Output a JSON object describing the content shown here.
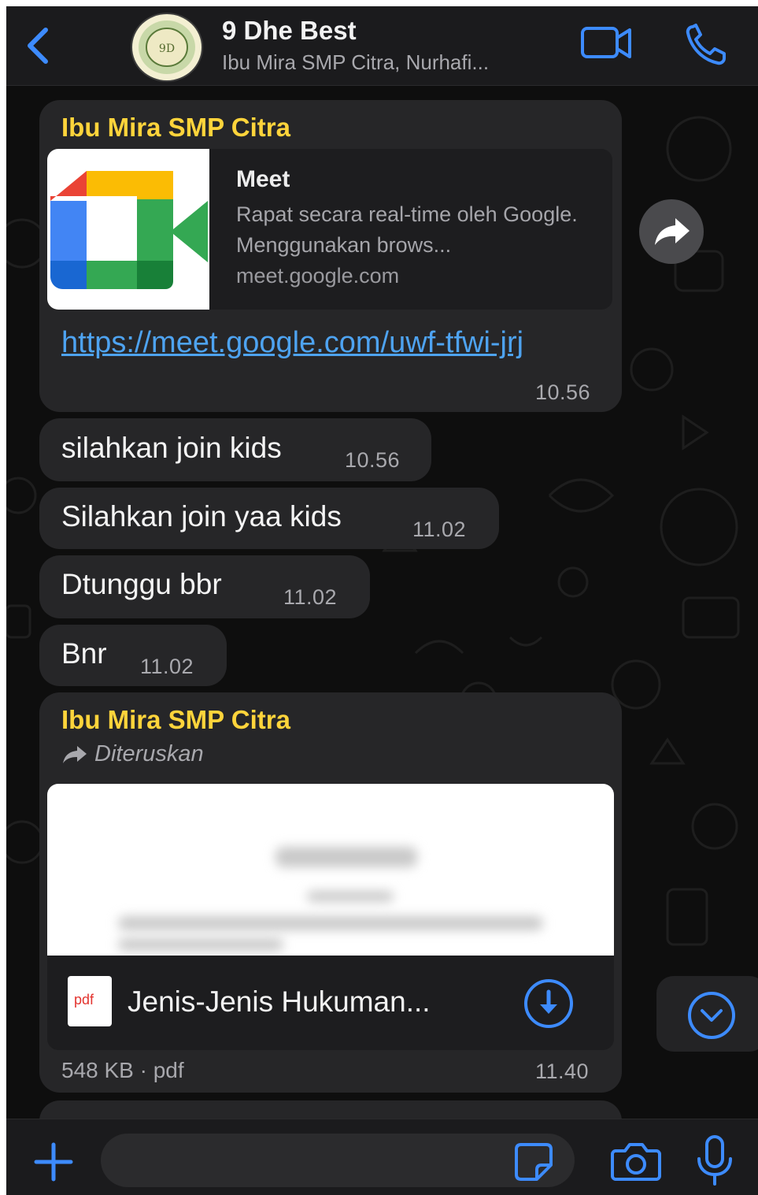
{
  "header": {
    "title": "9 Dhe Best",
    "subtitle": "Ibu Mira SMP Citra, Nurhafi...",
    "avatar_text": "9D"
  },
  "messages": {
    "link_message": {
      "sender": "Ibu Mira SMP Citra",
      "preview_title": "Meet",
      "preview_description": "Rapat secara real-time oleh Google. Menggunakan brows...",
      "preview_domain": "meet.google.com",
      "link": "https://meet.google.com/uwf-tfwi-jrj",
      "time": "10.56"
    },
    "text_messages": [
      {
        "text": "silahkan join kids",
        "time": "10.56"
      },
      {
        "text": "Silahkan join yaa kids",
        "time": "11.02"
      },
      {
        "text": "Dtunggu bbr",
        "time": "11.02"
      },
      {
        "text": "Bnr",
        "time": "11.02"
      }
    ],
    "document_message": {
      "sender": "Ibu Mira SMP Citra",
      "forwarded_label": "Diteruskan",
      "file_icon_label": "pdf",
      "file_name": "Jenis-Jenis Hukuman...",
      "file_meta": "548 KB · pdf",
      "time": "11.40"
    }
  },
  "input": {
    "placeholder": ""
  },
  "colors": {
    "accent": "#3d8bfd",
    "sender": "#ffd43b",
    "link": "#4ea3f1",
    "bubble": "#262628",
    "background": "#0b0b0b"
  },
  "icons": [
    "back-chevron-icon",
    "video-call-icon",
    "phone-icon",
    "share-forward-icon",
    "forward-arrow-icon",
    "pdf-file-icon",
    "download-icon",
    "chevron-down-icon",
    "plus-icon",
    "sticker-icon",
    "camera-icon",
    "microphone-icon"
  ]
}
